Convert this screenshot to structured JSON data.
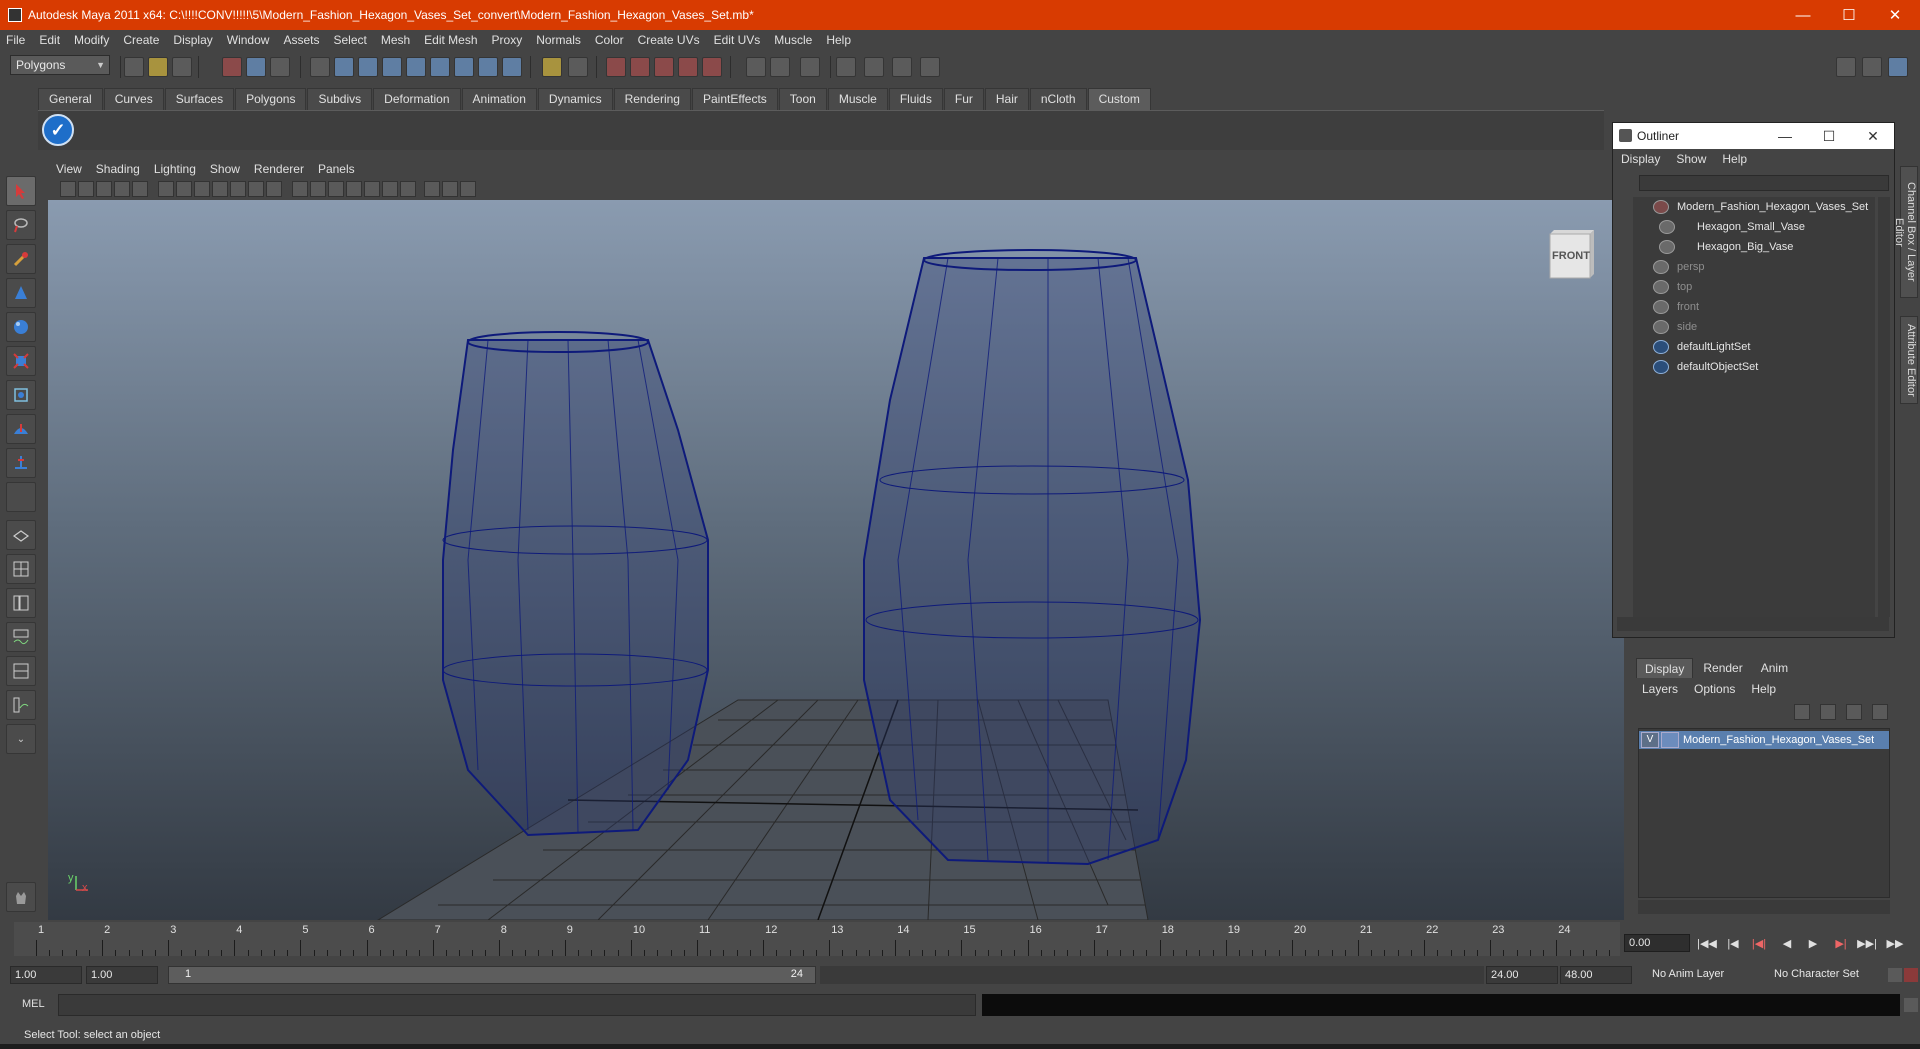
{
  "window": {
    "title": "Autodesk Maya 2011 x64: C:\\!!!!CONV!!!!!\\5\\Modern_Fashion_Hexagon_Vases_Set_convert\\Modern_Fashion_Hexagon_Vases_Set.mb*",
    "minimize": "—",
    "maximize": "☐",
    "close": "✕"
  },
  "menubar": [
    "File",
    "Edit",
    "Modify",
    "Create",
    "Display",
    "Window",
    "Assets",
    "Select",
    "Mesh",
    "Edit Mesh",
    "Proxy",
    "Normals",
    "Color",
    "Create UVs",
    "Edit UVs",
    "Muscle",
    "Help"
  ],
  "statusline": {
    "mode": "Polygons"
  },
  "shelf": {
    "tabs": [
      "General",
      "Curves",
      "Surfaces",
      "Polygons",
      "Subdivs",
      "Deformation",
      "Animation",
      "Dynamics",
      "Rendering",
      "PaintEffects",
      "Toon",
      "Muscle",
      "Fluids",
      "Fur",
      "Hair",
      "nCloth",
      "Custom"
    ],
    "active_tab": "Custom",
    "icon_glyph": "✓"
  },
  "panel": {
    "menu": [
      "View",
      "Shading",
      "Lighting",
      "Show",
      "Renderer",
      "Panels"
    ],
    "viewcube_label": "FRONT",
    "axis_y": "y",
    "axis_x": "x"
  },
  "outliner": {
    "title": "Outliner",
    "menu": [
      "Display",
      "Show",
      "Help"
    ],
    "items": [
      {
        "label": "Modern_Fashion_Hexagon_Vases_Set",
        "dim": false,
        "indent": 0
      },
      {
        "label": "Hexagon_Small_Vase",
        "dim": false,
        "indent": 1
      },
      {
        "label": "Hexagon_Big_Vase",
        "dim": false,
        "indent": 1
      },
      {
        "label": "persp",
        "dim": true,
        "indent": 0
      },
      {
        "label": "top",
        "dim": true,
        "indent": 0
      },
      {
        "label": "front",
        "dim": true,
        "indent": 0
      },
      {
        "label": "side",
        "dim": true,
        "indent": 0
      },
      {
        "label": "defaultLightSet",
        "dim": false,
        "indent": 0
      },
      {
        "label": "defaultObjectSet",
        "dim": false,
        "indent": 0
      }
    ]
  },
  "sidetabs": [
    "Channel Box / Layer Editor",
    "Attribute Editor"
  ],
  "layer_editor": {
    "tabs": [
      "Display",
      "Render",
      "Anim"
    ],
    "active_tab": "Display",
    "menu": [
      "Layers",
      "Options",
      "Help"
    ],
    "layer": {
      "visible": "V",
      "name": "Modern_Fashion_Hexagon_Vases_Set"
    }
  },
  "timeslider": {
    "frames": [
      "1",
      "2",
      "3",
      "4",
      "5",
      "6",
      "7",
      "8",
      "9",
      "10",
      "11",
      "12",
      "13",
      "14",
      "15",
      "16",
      "17",
      "18",
      "19",
      "20",
      "21",
      "22",
      "23",
      "24"
    ],
    "current_frame": "0.00"
  },
  "playback": [
    "|◀◀",
    "|◀",
    "|◀|",
    "◀",
    "▶",
    "▶|",
    "▶▶|",
    "▶▶"
  ],
  "range": {
    "start": "1.00",
    "anim_start": "1.00",
    "range_start": "1",
    "range_end": "24",
    "anim_end": "24.00",
    "end": "48.00",
    "anim_layer": "No Anim Layer",
    "character_set": "No Character Set"
  },
  "command": {
    "label": "MEL"
  },
  "helpline": {
    "text": "Select Tool: select an object"
  }
}
